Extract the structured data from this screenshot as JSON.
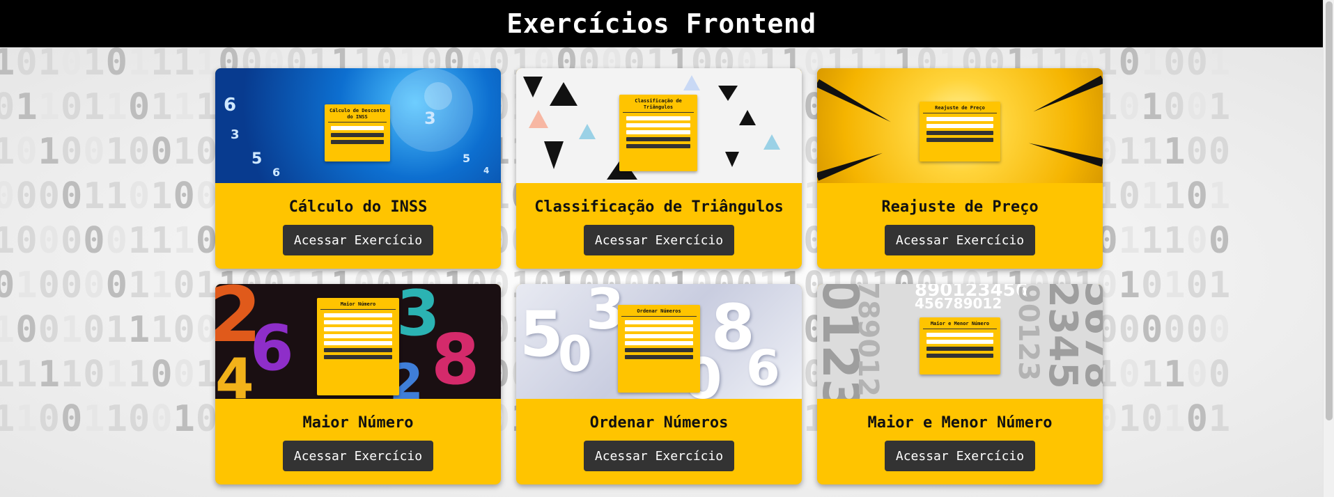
{
  "header": {
    "title": "Exercícios Frontend"
  },
  "button_label": "Acessar Exercício",
  "cards": [
    {
      "title": "Cálculo do INSS",
      "preview_title": "Cálculo de Desconto do INSS"
    },
    {
      "title": "Classificação de Triângulos",
      "preview_title": "Classificação de Triângulos"
    },
    {
      "title": "Reajuste de Preço",
      "preview_title": "Reajuste de Preço"
    },
    {
      "title": "Maior Número",
      "preview_title": "Maior Número"
    },
    {
      "title": "Ordenar Números",
      "preview_title": "Ordenar Números"
    },
    {
      "title": "Maior e Menor Número",
      "preview_title": "Maior e Menor Número"
    }
  ],
  "background_binary": [
    "1010101111000011101000010000011000110111101001110101001",
    "0110110111001101001011010011011001100011001110100101001",
    "1010010010000000111110111110011010010110110100101011100",
    "0000110100010000000000100001001001001101111001101101101",
    "1000001110100100011100001100100011000110111110000011100",
    "0100001101100111001010010100001000110101001011001010101",
    "1001011100011101000110011000001100100001100110000000000",
    "1111011001111010100011001100110111100110101100000101100",
    "1100110010111100110010010000110000101001111000111010101"
  ],
  "colors": {
    "accent": "#ffc400",
    "button": "#333333",
    "header_bg": "#000000"
  }
}
